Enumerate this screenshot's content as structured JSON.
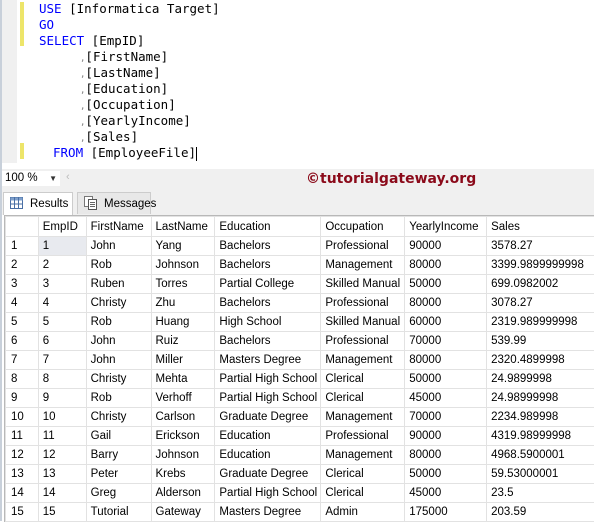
{
  "editor": {
    "lines": [
      {
        "kw": "USE",
        "rest": " [Informatica Target]"
      },
      {
        "kw": "GO",
        "rest": ""
      },
      {
        "kw": "SELECT",
        "rest": " [EmpID]"
      },
      {
        "comma": ",",
        "rest": "[FirstName]"
      },
      {
        "comma": ",",
        "rest": "[LastName]"
      },
      {
        "comma": ",",
        "rest": "[Education]"
      },
      {
        "comma": ",",
        "rest": "[Occupation]"
      },
      {
        "comma": ",",
        "rest": "[YearlyIncome]"
      },
      {
        "comma": ",",
        "rest": "[Sales]"
      },
      {
        "kw": "FROM",
        "rest": " [EmployeeFile]"
      }
    ]
  },
  "statusbar": {
    "zoom_level": "100 %",
    "watermark": "©tutorialgateway.org"
  },
  "tabs": {
    "results": "Results",
    "messages": "Messages"
  },
  "grid": {
    "columns": [
      "",
      "EmpID",
      "FirstName",
      "LastName",
      "Education",
      "Occupation",
      "YearlyIncome",
      "Sales"
    ],
    "rows": [
      [
        "1",
        "1",
        "John",
        "Yang",
        "Bachelors",
        "Professional",
        "90000",
        "3578.27"
      ],
      [
        "2",
        "2",
        "Rob",
        "Johnson",
        "Bachelors",
        "Management",
        "80000",
        "3399.9899999998"
      ],
      [
        "3",
        "3",
        "Ruben",
        "Torres",
        "Partial College",
        "Skilled Manual",
        "50000",
        "699.0982002"
      ],
      [
        "4",
        "4",
        "Christy",
        "Zhu",
        "Bachelors",
        "Professional",
        "80000",
        "3078.27"
      ],
      [
        "5",
        "5",
        "Rob",
        "Huang",
        "High School",
        "Skilled Manual",
        "60000",
        "2319.989999998"
      ],
      [
        "6",
        "6",
        "John",
        "Ruiz",
        "Bachelors",
        "Professional",
        "70000",
        "539.99"
      ],
      [
        "7",
        "7",
        "John",
        "Miller",
        "Masters Degree",
        "Management",
        "80000",
        "2320.4899998"
      ],
      [
        "8",
        "8",
        "Christy",
        "Mehta",
        "Partial High School",
        "Clerical",
        "50000",
        "24.9899998"
      ],
      [
        "9",
        "9",
        "Rob",
        "Verhoff",
        "Partial High School",
        "Clerical",
        "45000",
        "24.98999998"
      ],
      [
        "10",
        "10",
        "Christy",
        "Carlson",
        "Graduate Degree",
        "Management",
        "70000",
        "2234.989998"
      ],
      [
        "11",
        "11",
        "Gail",
        "Erickson",
        "Education",
        "Professional",
        "90000",
        "4319.98999998"
      ],
      [
        "12",
        "12",
        "Barry",
        "Johnson",
        "Education",
        "Management",
        "80000",
        "4968.5900001"
      ],
      [
        "13",
        "13",
        "Peter",
        "Krebs",
        "Graduate Degree",
        "Clerical",
        "50000",
        "59.53000001"
      ],
      [
        "14",
        "14",
        "Greg",
        "Alderson",
        "Partial High School",
        "Clerical",
        "45000",
        "23.5"
      ],
      [
        "15",
        "15",
        "Tutorial",
        "Gateway",
        "Masters Degree",
        "Admin",
        "175000",
        "203.59"
      ]
    ]
  }
}
